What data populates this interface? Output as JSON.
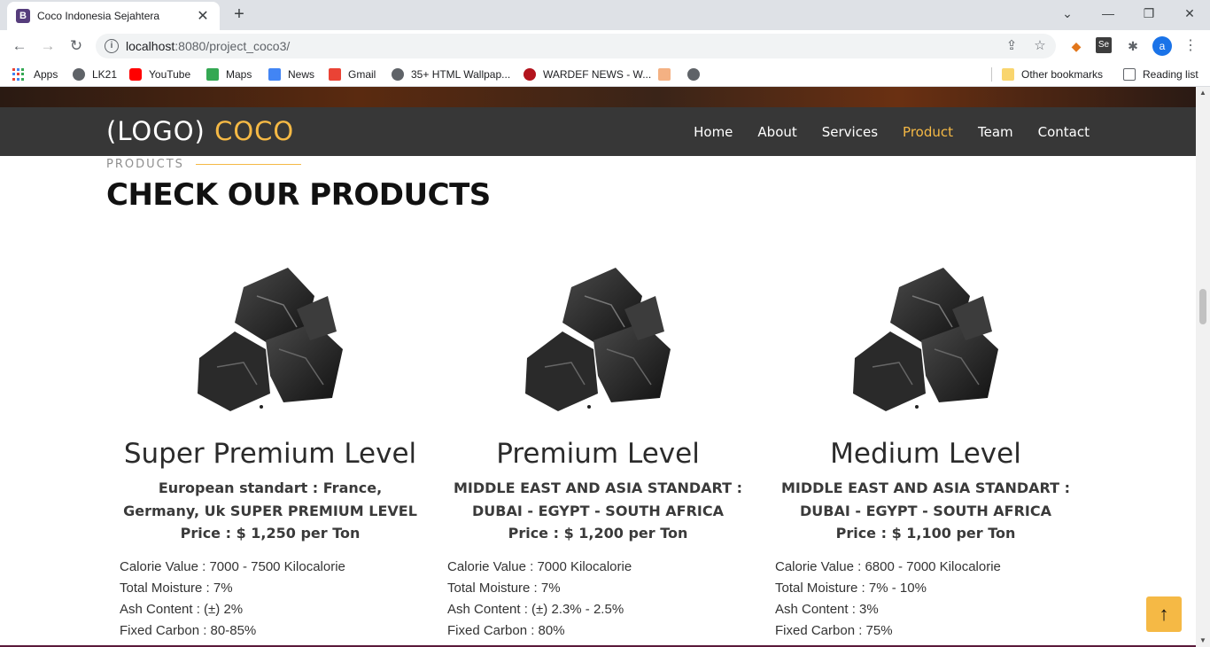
{
  "browser": {
    "tab_title": "Coco Indonesia Sejahtera",
    "tab_favicon_letter": "B",
    "url_host": "localhost",
    "url_rest": ":8080/project_coco3/",
    "avatar_letter": "a",
    "bookmarks": [
      {
        "label": "Apps",
        "icon": "apps-grid-icon"
      },
      {
        "label": "LK21",
        "icon": "globe-icon"
      },
      {
        "label": "YouTube",
        "icon": "youtube-icon"
      },
      {
        "label": "Maps",
        "icon": "maps-icon"
      },
      {
        "label": "News",
        "icon": "news-icon"
      },
      {
        "label": "Gmail",
        "icon": "gmail-icon"
      },
      {
        "label": "35+ HTML Wallpap...",
        "icon": "globe-icon"
      },
      {
        "label": "WARDEF NEWS - W...",
        "icon": "wardef-icon"
      }
    ],
    "other_bookmarks": "Other bookmarks",
    "reading_list": "Reading list"
  },
  "site": {
    "logo_prefix": "(LOGO)",
    "logo_accent": "COCO",
    "menu": [
      {
        "label": "Home",
        "active": false
      },
      {
        "label": "About",
        "active": false
      },
      {
        "label": "Services",
        "active": false
      },
      {
        "label": "Product",
        "active": true
      },
      {
        "label": "Team",
        "active": false
      },
      {
        "label": "Contact",
        "active": false
      }
    ],
    "accent_color": "#f5b945",
    "nav_bg": "#373737"
  },
  "products": {
    "kicker": "PRODUCTS",
    "title": "CHECK OUR PRODUCTS",
    "cards": [
      {
        "title": "Super Premium Level",
        "standard": "European standart : France, Germany, Uk SUPER PREMIUM LEVEL",
        "price": "Price : $ 1,250 per Ton",
        "specs": [
          "Calorie Value : 7000 - 7500 Kilocalorie",
          "Total Moisture : 7%",
          "Ash Content : (±) 2%",
          "Fixed Carbon : 80-85%"
        ]
      },
      {
        "title": "Premium Level",
        "standard": "MIDDLE EAST AND ASIA STANDART : DUBAI - EGYPT - SOUTH AFRICA",
        "price": "Price : $ 1,200 per Ton",
        "specs": [
          "Calorie Value : 7000 Kilocalorie",
          "Total Moisture : 7%",
          "Ash Content : (±) 2.3% - 2.5%",
          "Fixed Carbon : 80%"
        ]
      },
      {
        "title": "Medium Level",
        "standard": "MIDDLE EAST AND ASIA STANDART : DUBAI - EGYPT - SOUTH AFRICA",
        "price": "Price : $ 1,100 per Ton",
        "specs": [
          "Calorie Value : 6800 - 7000 Kilocalorie",
          "Total Moisture : 7% - 10%",
          "Ash Content : 3%",
          "Fixed Carbon : 75%"
        ]
      }
    ]
  }
}
